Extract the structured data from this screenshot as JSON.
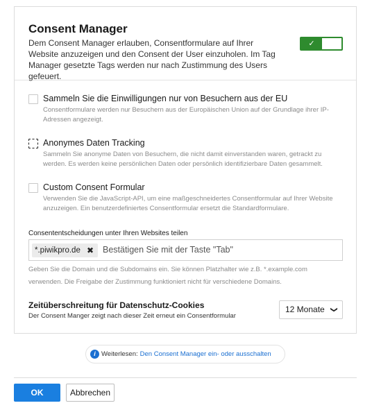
{
  "header": {
    "title": "Consent Manager",
    "description": "Dem Consent Manager erlauben, Consentformulare auf Ihrer Website anzuzeigen und den Consent der User einzuholen. Im Tag Manager gesetzte Tags werden nur nach Zustimmung des Users gefeuert.",
    "toggle_state": "on",
    "toggle_glyph": "✓"
  },
  "options": [
    {
      "label": "Sammeln Sie die Einwilligungen nur von Besuchern aus der EU",
      "help": "Consentformulare werden nur Besuchern aus der Europäischen Union auf der Grundlage ihrer IP-Adressen angezeigt.",
      "checked": false
    },
    {
      "label": "Anonymes Daten Tracking",
      "help": "Sammeln Sie anonyme Daten von Besuchern, die nicht damit einverstanden waren, getrackt zu werden. Es werden keine persönlichen Daten oder persönlich identifizierbare Daten gesammelt.",
      "checked": false
    },
    {
      "label": "Custom Consent Formular",
      "help": "Verwenden Sie die JavaScript-API, um eine maßgeschneidertes Consentformular auf Ihrer Website anzuzeigen. Ein benutzerdefiniertes Consentformular ersetzt die Standardformulare.",
      "checked": false
    }
  ],
  "share": {
    "label": "Consententscheidungen unter Ihren Websites teilen",
    "chip": "*.piwikpro.de",
    "chip_remove": "✖",
    "placeholder": "Bestätigen Sie mit der Taste \"Tab\"",
    "help": "Geben Sie die Domain und die Subdomains ein. Sie können Platzhalter wie z.B. *.example.com verwenden. Die Freigabe der Zustimmung funktioniert nicht für verschiedene Domains."
  },
  "timeout": {
    "title": "Zeitüberschreitung für Datenschutz-Cookies",
    "help": "Der Consent Manger zeigt nach dieser Zeit erneut ein Consentformular",
    "selected": "12 Monate"
  },
  "info": {
    "prefix": "Weiterlesen:",
    "link": "Den Consent Manager ein- oder ausschalten",
    "icon": "i"
  },
  "footer": {
    "ok_label": "OK",
    "cancel_label": "Abbrechen"
  },
  "colors": {
    "accent": "#1a7fe0",
    "toggle_on": "#2e8b2e",
    "link": "#1a6fd1"
  }
}
